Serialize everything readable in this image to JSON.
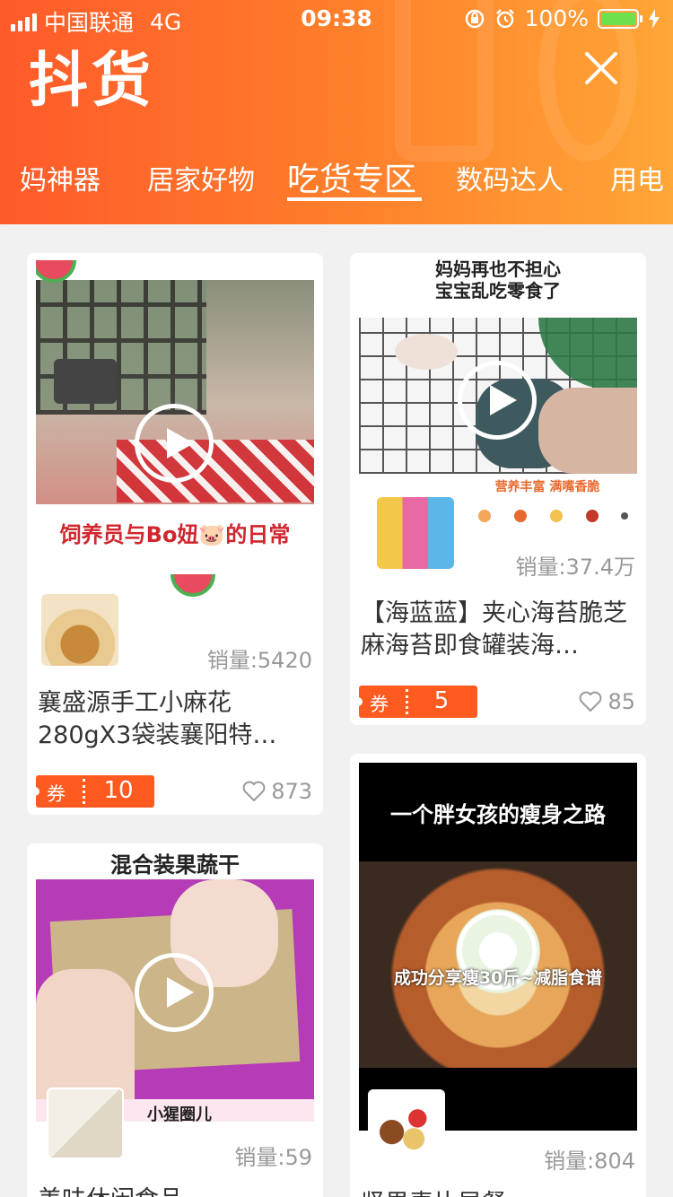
{
  "status_bar": {
    "carrier": "中国联通",
    "network": "4G",
    "time": "09:38",
    "battery": "100%"
  },
  "header": {
    "title": "抖货",
    "tabs": [
      "妈神器",
      "居家好物",
      "吃货专区",
      "数码达人",
      "用电"
    ],
    "active_tab_index": 2
  },
  "colors": {
    "header_start": "#ff5a2a",
    "header_end": "#ffa637",
    "coupon": "#ff5a1f",
    "battery_fill": "#6ee04e"
  },
  "cards": [
    {
      "overlay": "饲养员与Bo妞🐷的日常",
      "sales": "销量:5420",
      "name": "襄盛源手工小麻花280gX3袋装襄阳特…",
      "coupon_label": "券",
      "coupon_value": "10",
      "likes": "873"
    },
    {
      "overlay": "妈妈再也不担心\n宝宝乱吃零食了",
      "overlay_small": "营养丰富 满嘴香脆",
      "sales": "销量:37.4万",
      "name": "【海蓝蓝】夹心海苔脆芝麻海苔即食罐装海…",
      "coupon_label": "券",
      "coupon_value": "5",
      "likes": "85"
    },
    {
      "overlay": "混合装果蔬干",
      "overlay_bottom": "小猩圈儿",
      "sales": "销量:59",
      "name": "美味休闲食品"
    },
    {
      "overlay": "一个胖女孩的瘦身之路",
      "overlay_mid": "成功分享瘦30斤~减脂食谱",
      "sales": "销量:804",
      "name": "坚果麦片早餐"
    }
  ]
}
